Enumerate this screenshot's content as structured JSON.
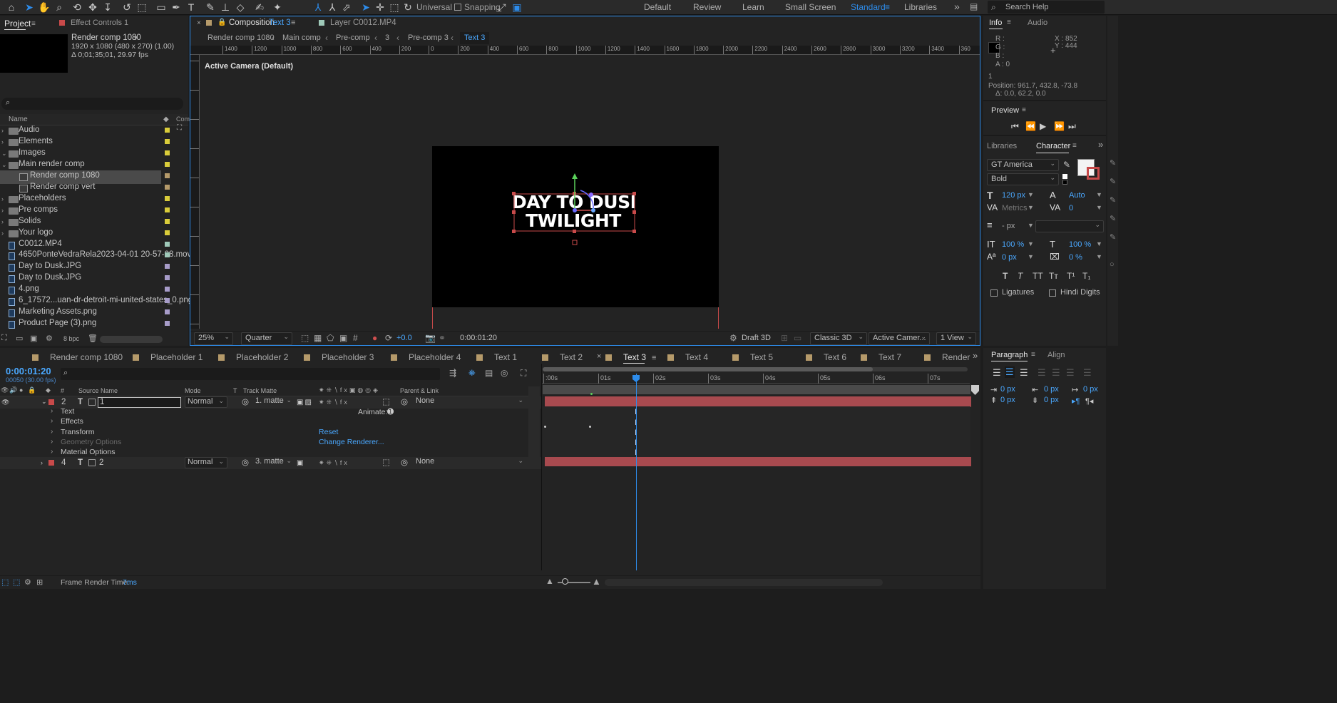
{
  "toolbar": {
    "axis_mode": "Universal",
    "snapping": "Snapping",
    "workspaces": [
      "Default",
      "Review",
      "Learn",
      "Small Screen",
      "Standard",
      "Libraries"
    ],
    "active_workspace": "Standard",
    "search_placeholder": "Search Help"
  },
  "project": {
    "tab_project": "Project",
    "tab_effect": "Effect Controls 1",
    "comp_name": "Render comp 1080",
    "comp_dims": "1920 x 1080  (480 x 270) (1.00)",
    "comp_duration": "Δ 0;01;35;01, 29.97 fps",
    "col_name": "Name",
    "col_com": "Com",
    "items": [
      {
        "name": "Audio",
        "type": "folder",
        "indent": 0,
        "color": "#d9cc3a"
      },
      {
        "name": "Elements",
        "type": "folder",
        "indent": 0,
        "color": "#d9cc3a"
      },
      {
        "name": "Images",
        "type": "folder",
        "indent": 0,
        "color": "#d9cc3a"
      },
      {
        "name": "Main render comp",
        "type": "folder",
        "indent": 0,
        "color": "#d9cc3a"
      },
      {
        "name": "Render comp 1080",
        "type": "comp",
        "indent": 1,
        "color": "#b59a6a"
      },
      {
        "name": "Render comp vert",
        "type": "comp",
        "indent": 1,
        "color": "#b59a6a"
      },
      {
        "name": "Placeholders",
        "type": "folder",
        "indent": 0,
        "color": "#d9cc3a"
      },
      {
        "name": "Pre comps",
        "type": "folder",
        "indent": 0,
        "color": "#d9cc3a"
      },
      {
        "name": "Solids",
        "type": "folder",
        "indent": 0,
        "color": "#d9cc3a"
      },
      {
        "name": "Your logo",
        "type": "folder",
        "indent": 0,
        "color": "#d9cc3a"
      },
      {
        "name": "C0012.MP4",
        "type": "file",
        "indent": 0,
        "color": "#9fc9b9"
      },
      {
        "name": "4650PonteVedraRela2023-04-01 20-57-08.mov",
        "type": "file",
        "indent": 0,
        "color": "#9fc9b9"
      },
      {
        "name": "Day to Dusk.JPG",
        "type": "file",
        "indent": 0,
        "color": "#a79cc9"
      },
      {
        "name": "Day to Dusk.JPG",
        "type": "file",
        "indent": 0,
        "color": "#a79cc9"
      },
      {
        "name": "4.png",
        "type": "file",
        "indent": 0,
        "color": "#a79cc9"
      },
      {
        "name": "6_17572...uan-dr-detroit-mi-united-states_0.png",
        "type": "file",
        "indent": 0,
        "color": "#a79cc9"
      },
      {
        "name": "Marketing Assets.png",
        "type": "file",
        "indent": 0,
        "color": "#a79cc9"
      },
      {
        "name": "Product Page (3).png",
        "type": "file",
        "indent": 0,
        "color": "#a79cc9"
      }
    ],
    "bpc": "8 bpc"
  },
  "composition": {
    "tab_label": "Composition",
    "tab_name": "Text 3",
    "layer_tab": "Layer  C0012.MP4",
    "breadcrumbs": [
      "Render comp 1080",
      "Main comp",
      "Pre-comp",
      "3",
      "Pre-comp 3",
      "Text 3"
    ],
    "ruler_labels": [
      "1400",
      "1200",
      "1000",
      "800",
      "600",
      "400",
      "200",
      "0",
      "200",
      "400",
      "600",
      "800",
      "1000",
      "1200",
      "1400",
      "1600",
      "1800",
      "2000",
      "2200",
      "2400",
      "2600",
      "2800",
      "3000",
      "3200",
      "3400",
      "360"
    ],
    "camera_label": "Active Camera (Default)",
    "text_line1": "DAY TO DUSK",
    "text_line2": "TWILIGHT",
    "zoom": "25%",
    "resolution": "Quarter",
    "exposure": "+0.0",
    "timecode": "0:00:01:20",
    "renderer": "Draft 3D",
    "renderer_mode": "Classic 3D",
    "camera_select": "Active Camer...",
    "view_select": "1 View"
  },
  "info": {
    "tab_info": "Info",
    "tab_audio": "Audio",
    "r": "R :",
    "g": "G :",
    "b": "B :",
    "a": "A :  0",
    "x": "X : 852",
    "y": "Y : 444",
    "line1": "1",
    "position": "Position: 961.7, 432.8, -73.8",
    "delta": "Δ: 0.0, 62.2, 0.0"
  },
  "preview": {
    "title": "Preview"
  },
  "character": {
    "tab_libraries": "Libraries",
    "tab_character": "Character",
    "font": "GT America",
    "style": "Bold",
    "size": "120 px",
    "leading": "Auto",
    "kerning": "Metrics",
    "tracking": "0",
    "stroke": "- px",
    "vscale": "100 %",
    "hscale": "100 %",
    "baseline": "0 px",
    "tsume": "0 %",
    "ligatures": "Ligatures",
    "hindi": "Hindi Digits"
  },
  "paragraph": {
    "tab_paragraph": "Paragraph",
    "tab_align": "Align",
    "indent1": "0 px",
    "indent2": "0 px",
    "indent3": "0 px",
    "space1": "0 px",
    "space2": "0 px"
  },
  "timeline": {
    "tabs": [
      "Render comp 1080",
      "Placeholder 1",
      "Placeholder 2",
      "Placeholder 3",
      "Placeholder 4",
      "Text 1",
      "Text 2",
      "Text 3",
      "Text 4",
      "Text 5",
      "Text 6",
      "Text 7",
      "Render"
    ],
    "active_tab": "Text 3",
    "timecode": "0:00:01:20",
    "frame": "00050 (30.00 fps)",
    "col_source": "Source Name",
    "col_mode": "Mode",
    "col_t": "T",
    "col_track": "Track Matte",
    "col_parent": "Parent & Link",
    "time_labels": [
      ":00s",
      "01s",
      "02s",
      "03s",
      "04s",
      "05s",
      "06s",
      "07s"
    ],
    "layers": [
      {
        "num": "2",
        "name": "1",
        "mode": "Normal",
        "matte": "1. matte",
        "parent": "None"
      },
      {
        "num": "4",
        "name": "2",
        "mode": "Normal",
        "matte": "3. matte",
        "parent": "None"
      }
    ],
    "props": [
      "Text",
      "Effects",
      "Transform",
      "Geometry Options",
      "Material Options"
    ],
    "animate": "Animate:",
    "reset": "Reset",
    "change_renderer": "Change Renderer...",
    "render_time_label": "Frame Render Time:",
    "render_time": "7ms"
  }
}
